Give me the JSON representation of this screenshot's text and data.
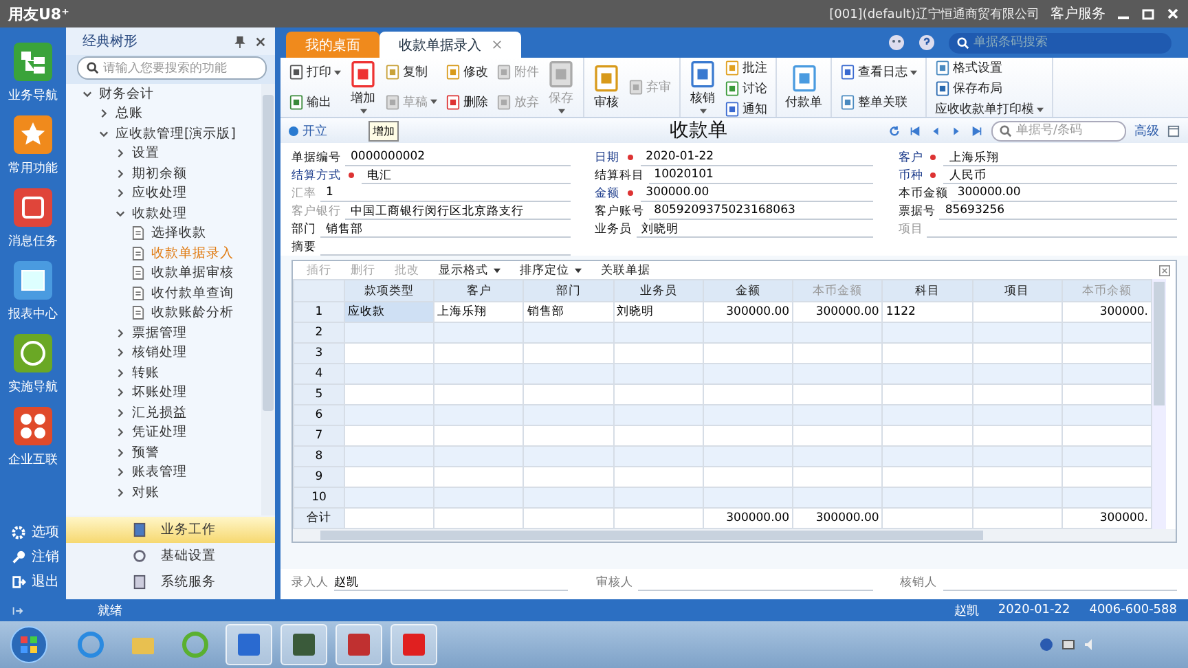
{
  "window": {
    "title": "用友U8⁺",
    "company": "[001](default)辽宁恒通商贸有限公司",
    "service": "客户服务"
  },
  "nav": [
    {
      "label": "业务导航",
      "kind": "tree"
    },
    {
      "label": "常用功能",
      "kind": "star"
    },
    {
      "label": "消息任务",
      "kind": "task"
    },
    {
      "label": "报表中心",
      "kind": "report"
    },
    {
      "label": "实施导航",
      "kind": "compass"
    },
    {
      "label": "企业互联",
      "kind": "link"
    }
  ],
  "nav_bottom": [
    {
      "label": "选项",
      "kind": "gear"
    },
    {
      "label": "注销",
      "kind": "key"
    },
    {
      "label": "退出",
      "kind": "exit"
    }
  ],
  "panel": {
    "title": "经典树形",
    "search": {
      "placeholder": "请输入您要搜索的功能"
    },
    "tree": [
      {
        "label": "财务会计",
        "expanded": true,
        "selected": false,
        "children": [
          {
            "label": "总账",
            "expanded": false,
            "selected": false
          },
          {
            "label": "应收款管理[演示版]",
            "expanded": true,
            "selected": false,
            "children": [
              {
                "label": "设置",
                "expanded": false,
                "selected": false
              },
              {
                "label": "期初余额",
                "expanded": false,
                "selected": false
              },
              {
                "label": "应收处理",
                "expanded": false,
                "selected": false
              },
              {
                "label": "收款处理",
                "expanded": true,
                "selected": false,
                "children": [
                  {
                    "label": "选择收款",
                    "kind": "doc",
                    "selected": false
                  },
                  {
                    "label": "收款单据录入",
                    "kind": "doc",
                    "selected": true
                  },
                  {
                    "label": "收款单据审核",
                    "kind": "doc",
                    "selected": false
                  },
                  {
                    "label": "收付款单查询",
                    "kind": "doc",
                    "selected": false
                  },
                  {
                    "label": "收款账龄分析",
                    "kind": "doc",
                    "selected": false
                  }
                ]
              },
              {
                "label": "票据管理",
                "expanded": false,
                "selected": false
              },
              {
                "label": "核销处理",
                "expanded": false,
                "selected": false
              },
              {
                "label": "转账",
                "expanded": false,
                "selected": false
              },
              {
                "label": "坏账处理",
                "expanded": false,
                "selected": false
              },
              {
                "label": "汇兑损益",
                "expanded": false,
                "selected": false
              },
              {
                "label": "凭证处理",
                "expanded": false,
                "selected": false
              },
              {
                "label": "预警",
                "expanded": false,
                "selected": false
              },
              {
                "label": "账表管理",
                "expanded": false,
                "selected": false
              },
              {
                "label": "对账",
                "expanded": false,
                "selected": false
              }
            ]
          }
        ]
      }
    ],
    "sections": [
      {
        "label": "业务工作",
        "kind": "work",
        "selected": true
      },
      {
        "label": "基础设置",
        "kind": "gear",
        "selected": false
      },
      {
        "label": "系统服务",
        "kind": "service",
        "selected": false
      }
    ]
  },
  "tabs": [
    {
      "label": "我的桌面",
      "selected": false,
      "closable": false
    },
    {
      "label": "收款单据录入",
      "selected": true,
      "closable": true
    }
  ],
  "top_search": {
    "placeholder": "单据条码搜索"
  },
  "toolbar": [
    [
      {
        "buttons": [
          {
            "label": "打印",
            "kind": "small",
            "disabled": false,
            "dropdown": true
          },
          {
            "label": "输出",
            "kind": "small",
            "disabled": false,
            "dropdown": false
          }
        ]
      },
      {
        "buttons": [
          {
            "label": "增加",
            "kind": "large",
            "disabled": false,
            "dropdown": true
          }
        ]
      },
      {
        "buttons": [
          {
            "label": "复制",
            "kind": "small",
            "disabled": false,
            "dropdown": false
          },
          {
            "label": "草稿",
            "kind": "small",
            "disabled": true,
            "dropdown": true
          }
        ]
      },
      {
        "buttons": [
          {
            "label": "修改",
            "kind": "small",
            "disabled": false,
            "dropdown": false
          },
          {
            "label": "删除",
            "kind": "small",
            "disabled": false,
            "dropdown": false
          }
        ]
      },
      {
        "buttons": [
          {
            "label": "附件",
            "kind": "small",
            "disabled": true,
            "dropdown": false
          },
          {
            "label": "放弃",
            "kind": "small",
            "disabled": true,
            "dropdown": false
          }
        ]
      },
      {
        "buttons": [
          {
            "label": "保存",
            "kind": "large",
            "disabled": true,
            "dropdown": true
          }
        ]
      }
    ],
    [
      {
        "buttons": [
          {
            "label": "审核",
            "kind": "large",
            "disabled": false,
            "dropdown": false
          }
        ]
      },
      {
        "buttons": [
          {
            "label": "弃审",
            "kind": "small",
            "disabled": true,
            "dropdown": false
          }
        ]
      }
    ],
    [
      {
        "buttons": [
          {
            "label": "核销",
            "kind": "large",
            "disabled": false,
            "dropdown": true
          }
        ]
      },
      {
        "buttons": [
          {
            "label": "批注",
            "kind": "small",
            "disabled": false,
            "dropdown": false
          },
          {
            "label": "讨论",
            "kind": "small",
            "disabled": false,
            "dropdown": false
          },
          {
            "label": "通知",
            "kind": "small",
            "disabled": false,
            "dropdown": false
          }
        ]
      }
    ],
    [
      {
        "buttons": [
          {
            "label": "付款单",
            "kind": "large",
            "disabled": false,
            "dropdown": false
          }
        ]
      }
    ],
    [
      {
        "buttons": [
          {
            "label": "查看日志",
            "kind": "small",
            "disabled": false,
            "dropdown": true
          },
          {
            "label": "整单关联",
            "kind": "small",
            "disabled": false,
            "dropdown": false
          }
        ]
      }
    ],
    [
      {
        "buttons": [
          {
            "label": "格式设置",
            "kind": "small",
            "disabled": false,
            "dropdown": false
          },
          {
            "label": "保存布局",
            "kind": "small",
            "disabled": false,
            "dropdown": false
          },
          {
            "label": "应收收款单打印模",
            "kind": "text",
            "disabled": false,
            "dropdown": true
          }
        ]
      }
    ]
  ],
  "tooltip": "增加",
  "form": {
    "status": "开立",
    "title": "收款单",
    "search": {
      "placeholder": "单据号/条码"
    },
    "advanced": "高级",
    "fields": [
      [
        {
          "label": "单据编号",
          "value": "0000000002",
          "kind": "plain",
          "required": false
        },
        {
          "label": "结算方式",
          "value": "电汇",
          "kind": "key",
          "required": true
        },
        {
          "label": "汇率",
          "value": "1",
          "kind": "disabled",
          "required": false
        },
        {
          "label": "客户银行",
          "value": "中国工商银行闵行区北京路支行",
          "kind": "disabled",
          "required": false
        },
        {
          "label": "部门",
          "value": "销售部",
          "kind": "plain",
          "required": false
        },
        {
          "label": "摘要",
          "kind": "plain",
          "required": false
        }
      ],
      [
        {
          "label": "日期",
          "value": "2020-01-22",
          "kind": "key",
          "required": true
        },
        {
          "label": "结算科目",
          "value": "10020101",
          "kind": "plain",
          "required": false
        },
        {
          "label": "金额",
          "value": "300000.00",
          "kind": "key",
          "required": true
        },
        {
          "label": "客户账号",
          "value": "8059209375023168063",
          "kind": "plain",
          "required": false
        },
        {
          "label": "业务员",
          "value": "刘晓明",
          "kind": "plain",
          "required": false
        }
      ],
      [
        {
          "label": "客户",
          "value": "上海乐翔",
          "kind": "key",
          "required": true
        },
        {
          "label": "币种",
          "value": "人民币",
          "kind": "key",
          "required": true
        },
        {
          "label": "本币金额",
          "value": "300000.00",
          "kind": "plain",
          "required": false
        },
        {
          "label": "票据号",
          "value": "85693256",
          "kind": "plain",
          "required": false
        },
        {
          "label": "项目",
          "kind": "disabled",
          "required": false
        }
      ]
    ]
  },
  "grid_toolbar": [
    {
      "label": "插行",
      "disabled": true,
      "dropdown": false
    },
    {
      "label": "删行",
      "disabled": true,
      "dropdown": false
    },
    {
      "label": "批改",
      "disabled": true,
      "dropdown": false
    },
    {
      "label": "显示格式",
      "disabled": false,
      "dropdown": true
    },
    {
      "label": "排序定位",
      "disabled": false,
      "dropdown": true
    },
    {
      "label": "关联单据",
      "disabled": false,
      "dropdown": false
    }
  ],
  "table": {
    "columns": [
      {
        "label": "款项类型",
        "disabled": false
      },
      {
        "label": "客户",
        "disabled": false
      },
      {
        "label": "部门",
        "disabled": false
      },
      {
        "label": "业务员",
        "disabled": false
      },
      {
        "label": "金额",
        "disabled": false
      },
      {
        "label": "本币金额",
        "disabled": true
      },
      {
        "label": "科目",
        "disabled": false
      },
      {
        "label": "项目",
        "disabled": false
      },
      {
        "label": "本币余额",
        "disabled": true
      }
    ],
    "rows": [
      {
        "number": "1",
        "selected": true,
        "cells": [
          "应收款",
          "上海乐翔",
          "销售部",
          "刘晓明",
          "300000.00",
          "300000.00",
          "1122",
          null,
          "300000."
        ]
      },
      {
        "number": "2",
        "selected": false
      },
      {
        "number": "3",
        "selected": false
      },
      {
        "number": "4",
        "selected": false
      },
      {
        "number": "5",
        "selected": false
      },
      {
        "number": "6",
        "selected": false
      },
      {
        "number": "7",
        "selected": false
      },
      {
        "number": "8",
        "selected": false
      },
      {
        "number": "9",
        "selected": false
      },
      {
        "number": "10",
        "selected": false
      }
    ],
    "total": {
      "label": "合计",
      "cells": [
        null,
        null,
        null,
        null,
        "300000.00",
        "300000.00",
        null,
        null,
        "300000."
      ]
    }
  },
  "signatures": [
    {
      "label": "录入人",
      "value": "赵凯"
    },
    {
      "label": "审核人"
    },
    {
      "label": "核销人"
    }
  ],
  "status_bar": {
    "status": "就绪",
    "user": "赵凯",
    "date": "2020-01-22",
    "phone": "4006-600-588"
  },
  "taskbar": [
    {
      "kind": "ie",
      "active": false
    },
    {
      "kind": "folder",
      "active": false
    },
    {
      "kind": "refresh",
      "active": false
    },
    {
      "kind": "vs",
      "active": true
    },
    {
      "kind": "chip",
      "active": true
    },
    {
      "kind": "chip-red",
      "active": true
    },
    {
      "kind": "u8",
      "active": true
    }
  ]
}
